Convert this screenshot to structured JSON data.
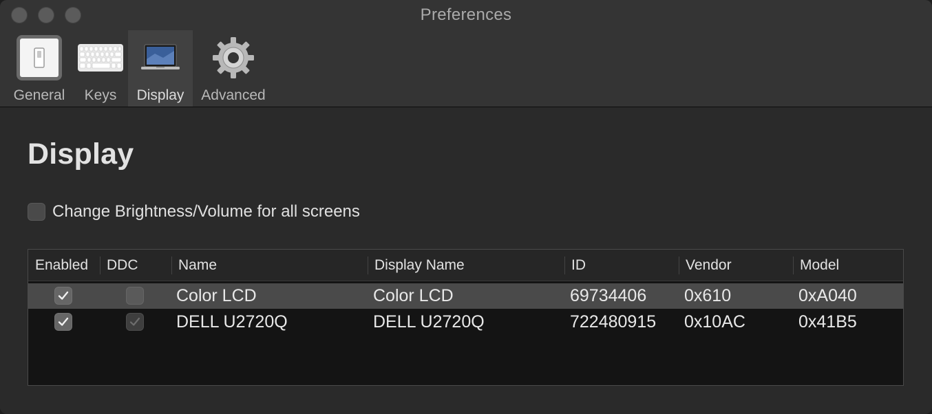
{
  "window": {
    "title": "Preferences"
  },
  "toolbar": {
    "tabs": [
      {
        "label": "General",
        "icon": "switch-icon"
      },
      {
        "label": "Keys",
        "icon": "keyboard-icon"
      },
      {
        "label": "Display",
        "icon": "laptop-display-icon",
        "selected": true
      },
      {
        "label": "Advanced",
        "icon": "gear-icon"
      }
    ]
  },
  "main": {
    "title": "Display",
    "all_screens": {
      "label": "Change Brightness/Volume for all screens",
      "checked": false
    },
    "table": {
      "columns": [
        "Enabled",
        "DDC",
        "Name",
        "Display Name",
        "ID",
        "Vendor",
        "Model"
      ],
      "rows": [
        {
          "enabled": true,
          "ddc": false,
          "name": "Color LCD",
          "display_name": "Color LCD",
          "id": "69734406",
          "vendor": "0x610",
          "model": "0xA040",
          "selected": true
        },
        {
          "enabled": true,
          "ddc": true,
          "ddc_disabled": true,
          "name": "DELL U2720Q",
          "display_name": "DELL U2720Q",
          "id": "722480915",
          "vendor": "0x10AC",
          "model": "0x41B5",
          "selected": false
        }
      ]
    }
  },
  "colors": {
    "background": "#2a2a2a",
    "toolbar": "#343434",
    "selected_row": "#4a4a4a",
    "text": "#e4e4e4"
  }
}
